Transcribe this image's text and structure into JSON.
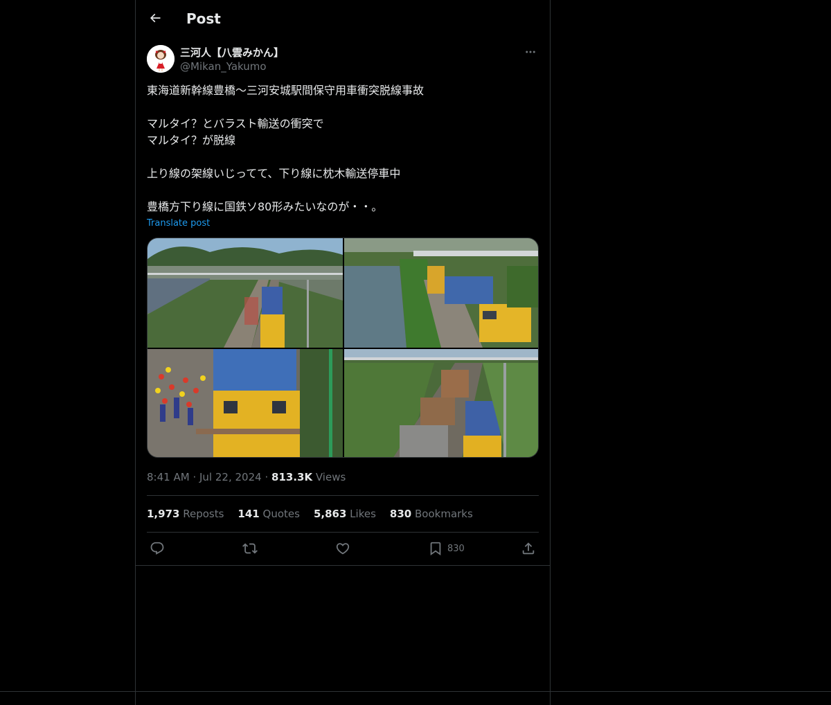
{
  "header": {
    "title": "Post"
  },
  "author": {
    "display_name": "三河人【八雲みかん】",
    "handle": "@Mikan_Yakumo"
  },
  "tweet": {
    "lines": [
      "東海道新幹線豊橋〜三河安城駅間保守用車衝突脱線事故",
      "",
      "マルタイ？とバラスト輸送の衝突で",
      "マルタイ？が脱線",
      "",
      "上り線の架線いじってて、下り線に枕木輸送停車中",
      "",
      "豊橋方下り線に国鉄ソ80形みたいなのが・・。"
    ],
    "translate_label": "Translate post"
  },
  "meta": {
    "time": "8:41 AM",
    "sep1": "·",
    "date": "Jul 22, 2024",
    "sep2": "·",
    "views_count": "813.3K",
    "views_label": "Views"
  },
  "stats": {
    "reposts_count": "1,973",
    "reposts_label": "Reposts",
    "quotes_count": "141",
    "quotes_label": "Quotes",
    "likes_count": "5,863",
    "likes_label": "Likes",
    "bookmarks_count": "830",
    "bookmarks_label": "Bookmarks"
  },
  "actions": {
    "reply_icon": "reply-icon",
    "repost_icon": "repost-icon",
    "like_icon": "heart-icon",
    "bookmark_icon": "bookmark-icon",
    "bookmark_count": "830",
    "share_icon": "share-icon"
  },
  "colors": {
    "background": "#000000",
    "text": "#e7e9ea",
    "muted": "#71767b",
    "link": "#1d9bf0",
    "border": "#2f3336"
  }
}
